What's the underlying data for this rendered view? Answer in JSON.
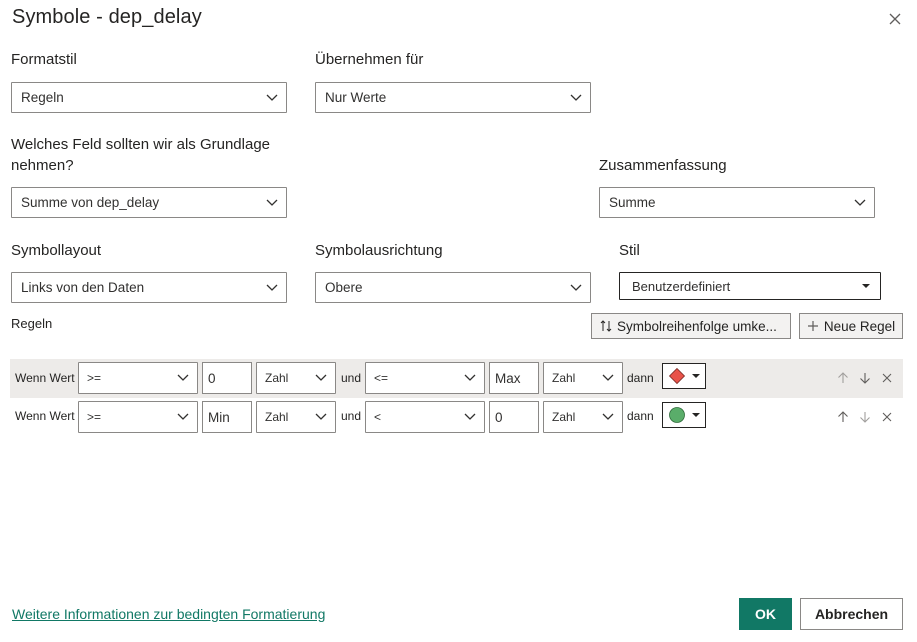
{
  "dialog": {
    "title": "Symbole - dep_delay"
  },
  "format_style": {
    "label": "Formatstil",
    "value": "Regeln"
  },
  "apply_to": {
    "label": "Übernehmen für",
    "value": "Nur Werte"
  },
  "base_field": {
    "label_line1": "Welches Feld sollten wir als Grundlage",
    "label_line2": "nehmen?",
    "value": "Summe von dep_delay"
  },
  "summary": {
    "label": "Zusammenfassung",
    "value": "Summe"
  },
  "icon_layout": {
    "label": "Symbollayout",
    "value": "Links von den Daten"
  },
  "icon_alignment": {
    "label": "Symbolausrichtung",
    "value": "Obere"
  },
  "style": {
    "label": "Stil",
    "value": "Benutzerdefiniert"
  },
  "rules": {
    "label": "Regeln",
    "reverse_button": "Symbolreihenfolge umke...",
    "new_rule_button": "Neue Regel",
    "rows": [
      {
        "if_label": "Wenn Wert",
        "op1": ">=",
        "value1": "0",
        "type1": "Zahl",
        "and_label": "und",
        "op2": "<=",
        "value2": "Max",
        "type2": "Zahl",
        "then_label": "dann",
        "icon": "red-diamond-icon",
        "icon_color": "#e8534a"
      },
      {
        "if_label": "Wenn Wert",
        "op1": ">=",
        "value1": "Min",
        "type1": "Zahl",
        "and_label": "und",
        "op2": "<",
        "value2": "0",
        "type2": "Zahl",
        "then_label": "dann",
        "icon": "green-circle-icon",
        "icon_color": "#5aad6a"
      }
    ]
  },
  "footer": {
    "link": "Weitere Informationen zur bedingten Formatierung",
    "ok": "OK",
    "cancel": "Abbrechen"
  },
  "colors": {
    "accent": "#117865",
    "row_highlight": "#edebe9"
  }
}
